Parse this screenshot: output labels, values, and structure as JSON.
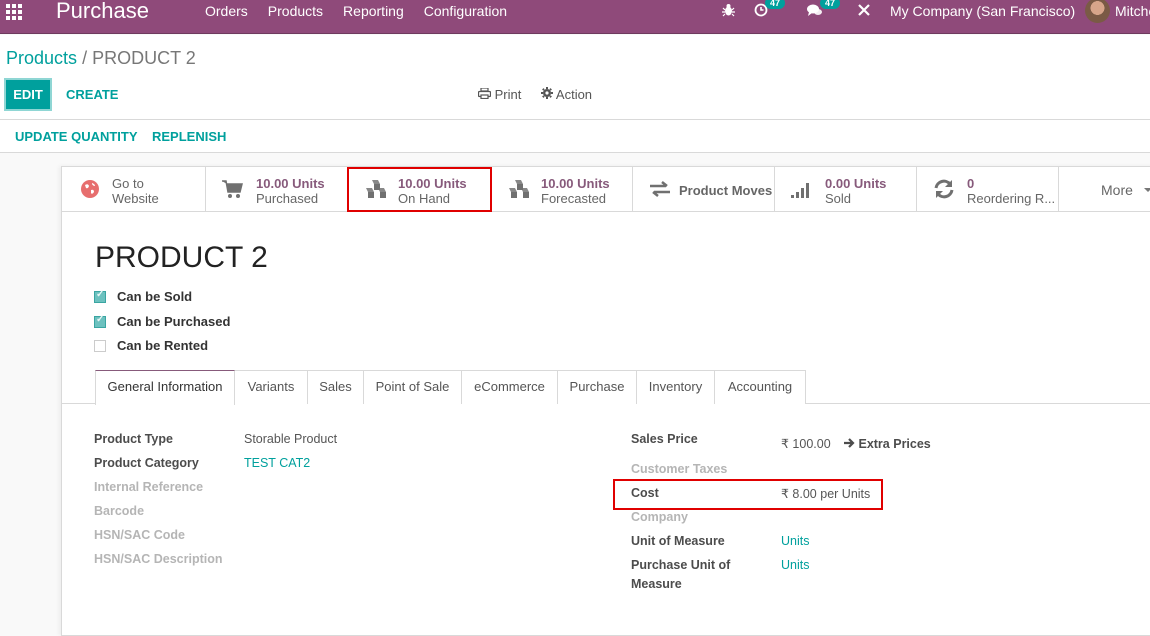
{
  "navbar": {
    "brand": "Purchase",
    "menu": [
      "Orders",
      "Products",
      "Reporting",
      "Configuration"
    ],
    "activity_count": "47",
    "message_count": "47",
    "company": "My Company (San Francisco)",
    "user": "Mitche"
  },
  "breadcrumb": {
    "parent": "Products",
    "separator": "/",
    "current": "PRODUCT 2"
  },
  "toolbar": {
    "edit_label": "EDIT",
    "create_label": "CREATE",
    "print_label": "Print",
    "action_label": "Action",
    "update_quantity_label": "UPDATE QUANTITY",
    "replenish_label": "REPLENISH"
  },
  "smart_buttons": [
    {
      "line1": "Go to",
      "line2": "Website",
      "icon": "globe-icon"
    },
    {
      "line1": "10.00 Units",
      "line2": "Purchased",
      "icon": "cart-icon"
    },
    {
      "line1": "10.00 Units",
      "line2": "On Hand",
      "icon": "cubes-icon"
    },
    {
      "line1": "10.00 Units",
      "line2": "Forecasted",
      "icon": "cubes-icon"
    },
    {
      "line1": "Product Moves",
      "icon": "exchange-icon"
    },
    {
      "line1": "0.00 Units",
      "line2": "Sold",
      "icon": "signal-icon"
    },
    {
      "line1": "0",
      "line2": "Reordering R...",
      "icon": "refresh-icon"
    },
    {
      "line1": "More",
      "icon": "caret-down-icon"
    }
  ],
  "product": {
    "name": "PRODUCT 2",
    "checkboxes": [
      {
        "label": "Can be Sold",
        "checked": true
      },
      {
        "label": "Can be Purchased",
        "checked": true
      },
      {
        "label": "Can be Rented",
        "checked": false
      }
    ]
  },
  "tabs": [
    "General Information",
    "Variants",
    "Sales",
    "Point of Sale",
    "eCommerce",
    "Purchase",
    "Inventory",
    "Accounting"
  ],
  "active_tab": "General Information",
  "left_fields": [
    {
      "label": "Product Type",
      "value": "Storable Product"
    },
    {
      "label": "Product Category",
      "value": "TEST CAT2"
    },
    {
      "label": "Internal Reference",
      "value": ""
    },
    {
      "label": "Barcode",
      "value": ""
    },
    {
      "label": "HSN/SAC Code",
      "value": ""
    },
    {
      "label": "HSN/SAC Description",
      "value": ""
    }
  ],
  "right_fields": {
    "sales_price_label": "Sales Price",
    "sales_price_value": "₹ 100.00",
    "extra_prices_label": "Extra Prices",
    "customer_taxes_label": "Customer Taxes",
    "cost_label": "Cost",
    "cost_value": "₹ 8.00",
    "cost_unit": "per Units",
    "company_label": "Company",
    "uom_label": "Unit of Measure",
    "uom_value": "Units",
    "purchase_uom_label_1": "Purchase Unit of",
    "purchase_uom_label_2": "Measure",
    "purchase_uom_value": "Units"
  },
  "colors": {
    "navbar": "#8f4a7a",
    "accent": "#00a09d",
    "highlight": "#e00000",
    "smart_value": "#875a7b"
  }
}
